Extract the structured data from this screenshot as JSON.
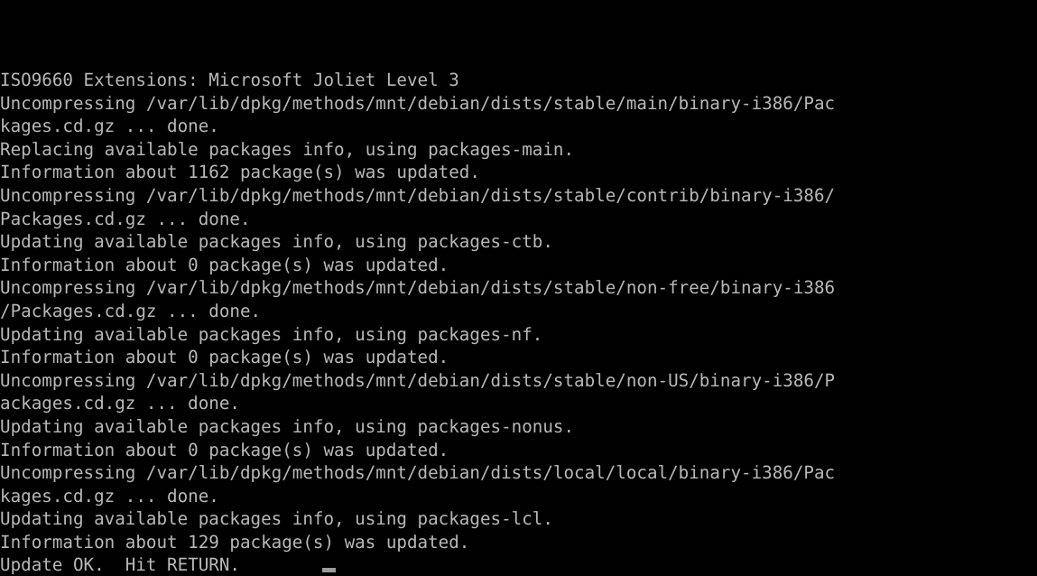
{
  "screen": {
    "title": "Debian dselect update console",
    "background_color": "#000000",
    "text_color": "#b8b8b8",
    "columns": 101,
    "rows": 22,
    "cursor": {
      "glyph": "block-cursor",
      "column": 24,
      "row": 22
    }
  },
  "console": {
    "lines": [
      "ISO9660 Extensions: Microsoft Joliet Level 3",
      "Uncompressing /var/lib/dpkg/methods/mnt/debian/dists/stable/main/binary-i386/Pac",
      "kages.cd.gz ... done.",
      "Replacing available packages info, using packages-main.",
      "Information about 1162 package(s) was updated.",
      "Uncompressing /var/lib/dpkg/methods/mnt/debian/dists/stable/contrib/binary-i386/",
      "Packages.cd.gz ... done.",
      "Updating available packages info, using packages-ctb.",
      "Information about 0 package(s) was updated.",
      "Uncompressing /var/lib/dpkg/methods/mnt/debian/dists/stable/non-free/binary-i386",
      "/Packages.cd.gz ... done.",
      "Updating available packages info, using packages-nf.",
      "Information about 0 package(s) was updated.",
      "Uncompressing /var/lib/dpkg/methods/mnt/debian/dists/stable/non-US/binary-i386/P",
      "ackages.cd.gz ... done.",
      "Updating available packages info, using packages-nonus.",
      "Information about 0 package(s) was updated.",
      "Uncompressing /var/lib/dpkg/methods/mnt/debian/dists/local/local/binary-i386/Pac",
      "kages.cd.gz ... done.",
      "Updating available packages info, using packages-lcl.",
      "Information about 129 package(s) was updated.",
      "Update OK.  Hit RETURN."
    ]
  }
}
